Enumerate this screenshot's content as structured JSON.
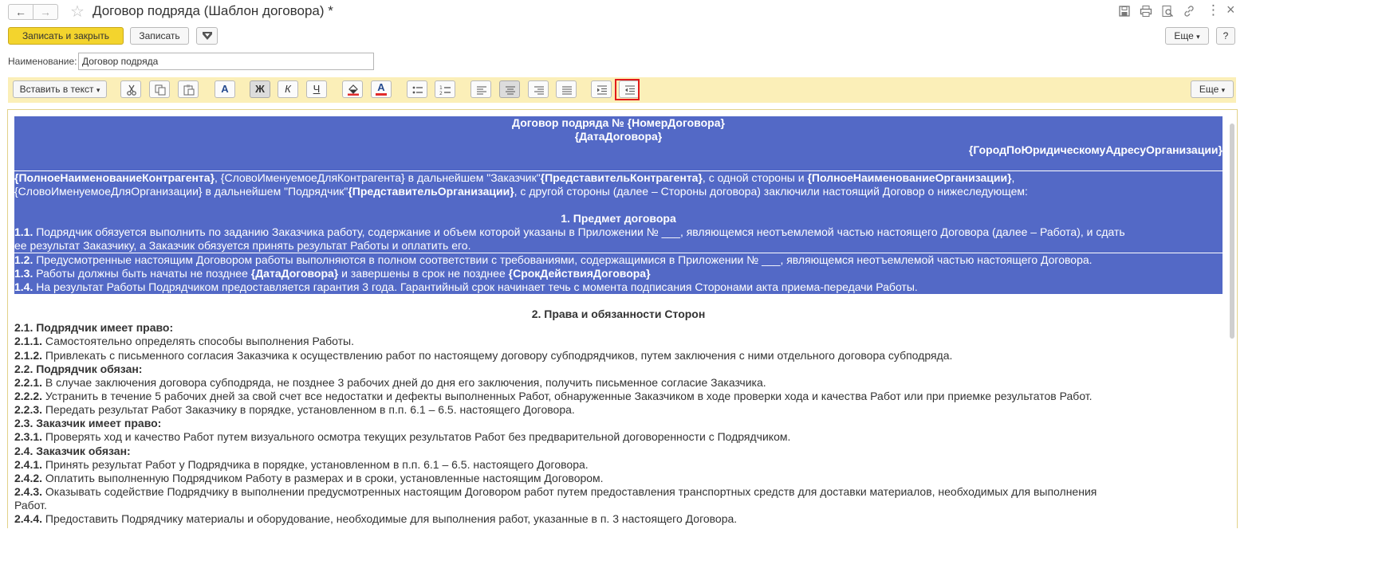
{
  "window": {
    "title": "Договор подряда (Шаблон договора) *",
    "back_glyph": "←",
    "forward_glyph": "→",
    "favorite_glyph": "☆",
    "title_icons": [
      "save-icon",
      "print-icon",
      "preview-icon",
      "link-icon",
      "more-vertical-icon",
      "close-icon"
    ],
    "more_vertical_glyph": "⋮",
    "close_glyph": "×"
  },
  "commandbar": {
    "save_close": "Записать и закрыть",
    "save": "Записать",
    "more": "Еще",
    "help": "?",
    "dropdown_glyph": "▾"
  },
  "name": {
    "label": "Наименование:",
    "value": "Договор подряда"
  },
  "format_toolbar": {
    "insert": "Вставить в текст",
    "more": "Еще",
    "bold": "Ж",
    "italic": "К",
    "underline": "Ч",
    "font": "A",
    "font_color": "A"
  },
  "document": {
    "selected": [
      {
        "align": "c",
        "parts": [
          {
            "t": "Договор подряда № {НомерДоговора}",
            "b": true
          }
        ]
      },
      {
        "align": "c",
        "parts": [
          {
            "t": "{ДатаДоговора}",
            "b": true
          }
        ]
      },
      {
        "align": "r",
        "parts": [
          {
            "t": "{ГородПоЮридическомуАдресуОрганизации}",
            "b": true
          }
        ]
      },
      {
        "align": "l",
        "parts": []
      },
      {
        "align": "l",
        "parts": [
          {
            "t": "{ПолноеНаименованиеКонтрагента}",
            "b": true
          },
          {
            "t": ", {СловоИменуемоеДляКонтрагента} в дальнейшем \"Заказчик\""
          },
          {
            "t": "{ПредставительКонтрагента}",
            "b": true
          },
          {
            "t": ", с одной стороны и "
          },
          {
            "t": "{ПолноеНаименованиеОрганизации}",
            "b": true
          },
          {
            "t": ","
          }
        ]
      },
      {
        "align": "l",
        "parts": [
          {
            "t": "{СловоИменуемоеДляОрганизации} в дальнейшем \"Подрядчик\""
          },
          {
            "t": "{ПредставительОрганизации}",
            "b": true
          },
          {
            "t": ", с другой стороны (далее – Стороны договора) заключили настоящий Договор о нижеследующем:"
          }
        ]
      },
      {
        "align": "l",
        "parts": []
      },
      {
        "align": "c",
        "parts": [
          {
            "t": "1. Предмет договора",
            "b": true
          }
        ]
      },
      {
        "align": "l",
        "parts": [
          {
            "t": "1.1.",
            "b": true
          },
          {
            "t": " Подрядчик обязуется выполнить по заданию Заказчика работу, содержание и объем которой указаны в Приложении № ___, являющемся неотъемлемой частью настоящего Договора (далее – Работа), и сдать"
          }
        ]
      },
      {
        "align": "l",
        "parts": [
          {
            "t": "ее результат Заказчику, а Заказчик обязуется принять результат Работы и оплатить его."
          }
        ]
      },
      {
        "align": "l",
        "parts": [
          {
            "t": "1.2.",
            "b": true
          },
          {
            "t": " Предусмотренные настоящим Договором работы выполняются в полном соответствии с требованиями, содержащимися в Приложении № ___, являющемся неотъемлемой частью настоящего Договора."
          }
        ]
      },
      {
        "align": "l",
        "parts": [
          {
            "t": "1.3.",
            "b": true
          },
          {
            "t": " Работы должны быть начаты не позднее "
          },
          {
            "t": "{ДатаДоговора}",
            "b": true
          },
          {
            "t": " и завершены в срок не позднее "
          },
          {
            "t": "{СрокДействияДоговора}",
            "b": true
          }
        ]
      },
      {
        "align": "l",
        "parts": [
          {
            "t": "1.4.",
            "b": true
          },
          {
            "t": " На результат Работы Подрядчиком предоставляется гарантия 3 года. Гарантийный срок начинает течь с момента подписания Сторонами акта приема-передачи Работы."
          }
        ]
      }
    ],
    "body": [
      {
        "align": "l",
        "parts": []
      },
      {
        "align": "c",
        "parts": [
          {
            "t": "2. Права и обязанности Сторон",
            "b": true
          }
        ]
      },
      {
        "align": "l",
        "parts": [
          {
            "t": "2.1. Подрядчик имеет право:",
            "b": true
          }
        ]
      },
      {
        "align": "l",
        "parts": [
          {
            "t": "2.1.1.",
            "b": true
          },
          {
            "t": " Самостоятельно определять способы выполнения Работы."
          }
        ]
      },
      {
        "align": "l",
        "parts": [
          {
            "t": "2.1.2.",
            "b": true
          },
          {
            "t": " Привлекать с письменного согласия Заказчика к осуществлению работ по настоящему договору субподрядчиков, путем заключения с ними отдельного договора субподряда."
          }
        ]
      },
      {
        "align": "l",
        "parts": [
          {
            "t": "2.2. Подрядчик обязан:",
            "b": true
          }
        ]
      },
      {
        "align": "l",
        "parts": [
          {
            "t": "2.2.1.",
            "b": true
          },
          {
            "t": " В случае заключения договора субподряда, не позднее 3 рабочих дней до дня его заключения, получить письменное согласие Заказчика."
          }
        ]
      },
      {
        "align": "l",
        "parts": [
          {
            "t": "2.2.2.",
            "b": true
          },
          {
            "t": " Устранить в течение 5 рабочих дней за свой счет все недостатки и дефекты выполненных Работ, обнаруженные Заказчиком в ходе проверки хода и качества Работ или при приемке результатов Работ."
          }
        ]
      },
      {
        "align": "l",
        "parts": [
          {
            "t": "2.2.3.",
            "b": true
          },
          {
            "t": " Передать результат Работ Заказчику в порядке, установленном в п.п. 6.1 – 6.5. настоящего Договора."
          }
        ]
      },
      {
        "align": "l",
        "parts": [
          {
            "t": "2.3. Заказчик имеет право:",
            "b": true
          }
        ]
      },
      {
        "align": "l",
        "parts": [
          {
            "t": "2.3.1.",
            "b": true
          },
          {
            "t": " Проверять ход и качество Работ путем визуального осмотра текущих результатов Работ без предварительной договоренности с Подрядчиком."
          }
        ]
      },
      {
        "align": "l",
        "parts": [
          {
            "t": "2.4. Заказчик обязан:",
            "b": true
          }
        ]
      },
      {
        "align": "l",
        "parts": [
          {
            "t": "2.4.1.",
            "b": true
          },
          {
            "t": " Принять результат Работ у Подрядчика в порядке, установленном в п.п. 6.1 – 6.5. настоящего Договора."
          }
        ]
      },
      {
        "align": "l",
        "parts": [
          {
            "t": "2.4.2.",
            "b": true
          },
          {
            "t": " Оплатить выполненную Подрядчиком Работу в размерах и в сроки, установленные настоящим Договором."
          }
        ]
      },
      {
        "align": "l",
        "parts": [
          {
            "t": "2.4.3.",
            "b": true
          },
          {
            "t": " Оказывать содействие Подрядчику в выполнении предусмотренных настоящим Договором работ путем предоставления транспортных средств для доставки материалов, необходимых для выполнения"
          }
        ]
      },
      {
        "align": "l",
        "parts": [
          {
            "t": "Работ."
          }
        ]
      },
      {
        "align": "l",
        "parts": [
          {
            "t": "2.4.4.",
            "b": true
          },
          {
            "t": " Предоставить Подрядчику материалы и оборудование, необходимые для выполнения работ, указанные в п. 3 настоящего Договора."
          }
        ]
      }
    ]
  }
}
